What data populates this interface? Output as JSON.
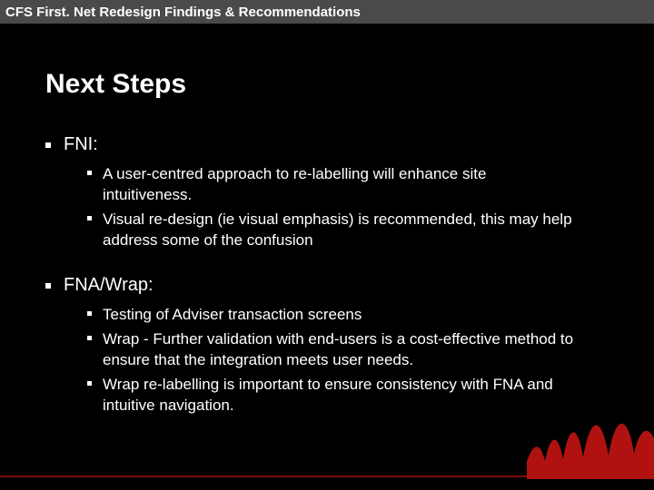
{
  "header": {
    "title": "CFS First. Net Redesign Findings & Recommendations"
  },
  "slide": {
    "title": "Next Steps",
    "sections": [
      {
        "label": "FNI:",
        "items": [
          "A user-centred approach to re-labelling will enhance site intuitiveness.",
          "Visual re-design (ie visual emphasis) is recommended, this may help address some of the confusion"
        ]
      },
      {
        "label": "FNA/Wrap:",
        "items": [
          "Testing of Adviser transaction screens",
          "Wrap - Further validation with end-users is a cost-effective method to ensure that the integration meets user needs.",
          "Wrap re-labelling is important to ensure consistency with FNA and intuitive navigation."
        ]
      }
    ]
  }
}
